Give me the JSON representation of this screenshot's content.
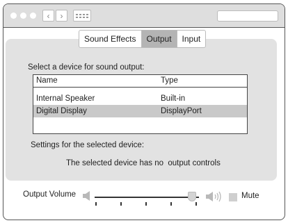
{
  "tabs": [
    {
      "label": "Sound Effects",
      "selected": false
    },
    {
      "label": "Output",
      "selected": true
    },
    {
      "label": "Input",
      "selected": false
    }
  ],
  "output": {
    "prompt": "Select a device for sound output:",
    "columns": [
      "Name",
      "Type"
    ],
    "devices": [
      {
        "name": "Internal Speaker",
        "type": "Built-in",
        "selected": false
      },
      {
        "name": "Digital Display",
        "type": "DisplayPort",
        "selected": true
      }
    ],
    "settings_label": "Settings for the selected device:",
    "no_controls_text": "The selected device has no  output controls"
  },
  "volume": {
    "label": "Output Volume",
    "level": 0.93,
    "mute_label": "Mute",
    "muted": false
  },
  "colors": {
    "titlebar": "#dedede",
    "panel": "#e2e2e2",
    "selected_tab": "#b4b4b4",
    "selected_row": "#c9c9c9"
  },
  "icons": [
    "back-icon",
    "forward-icon",
    "grid-icon",
    "speaker-low-icon",
    "speaker-high-icon"
  ]
}
